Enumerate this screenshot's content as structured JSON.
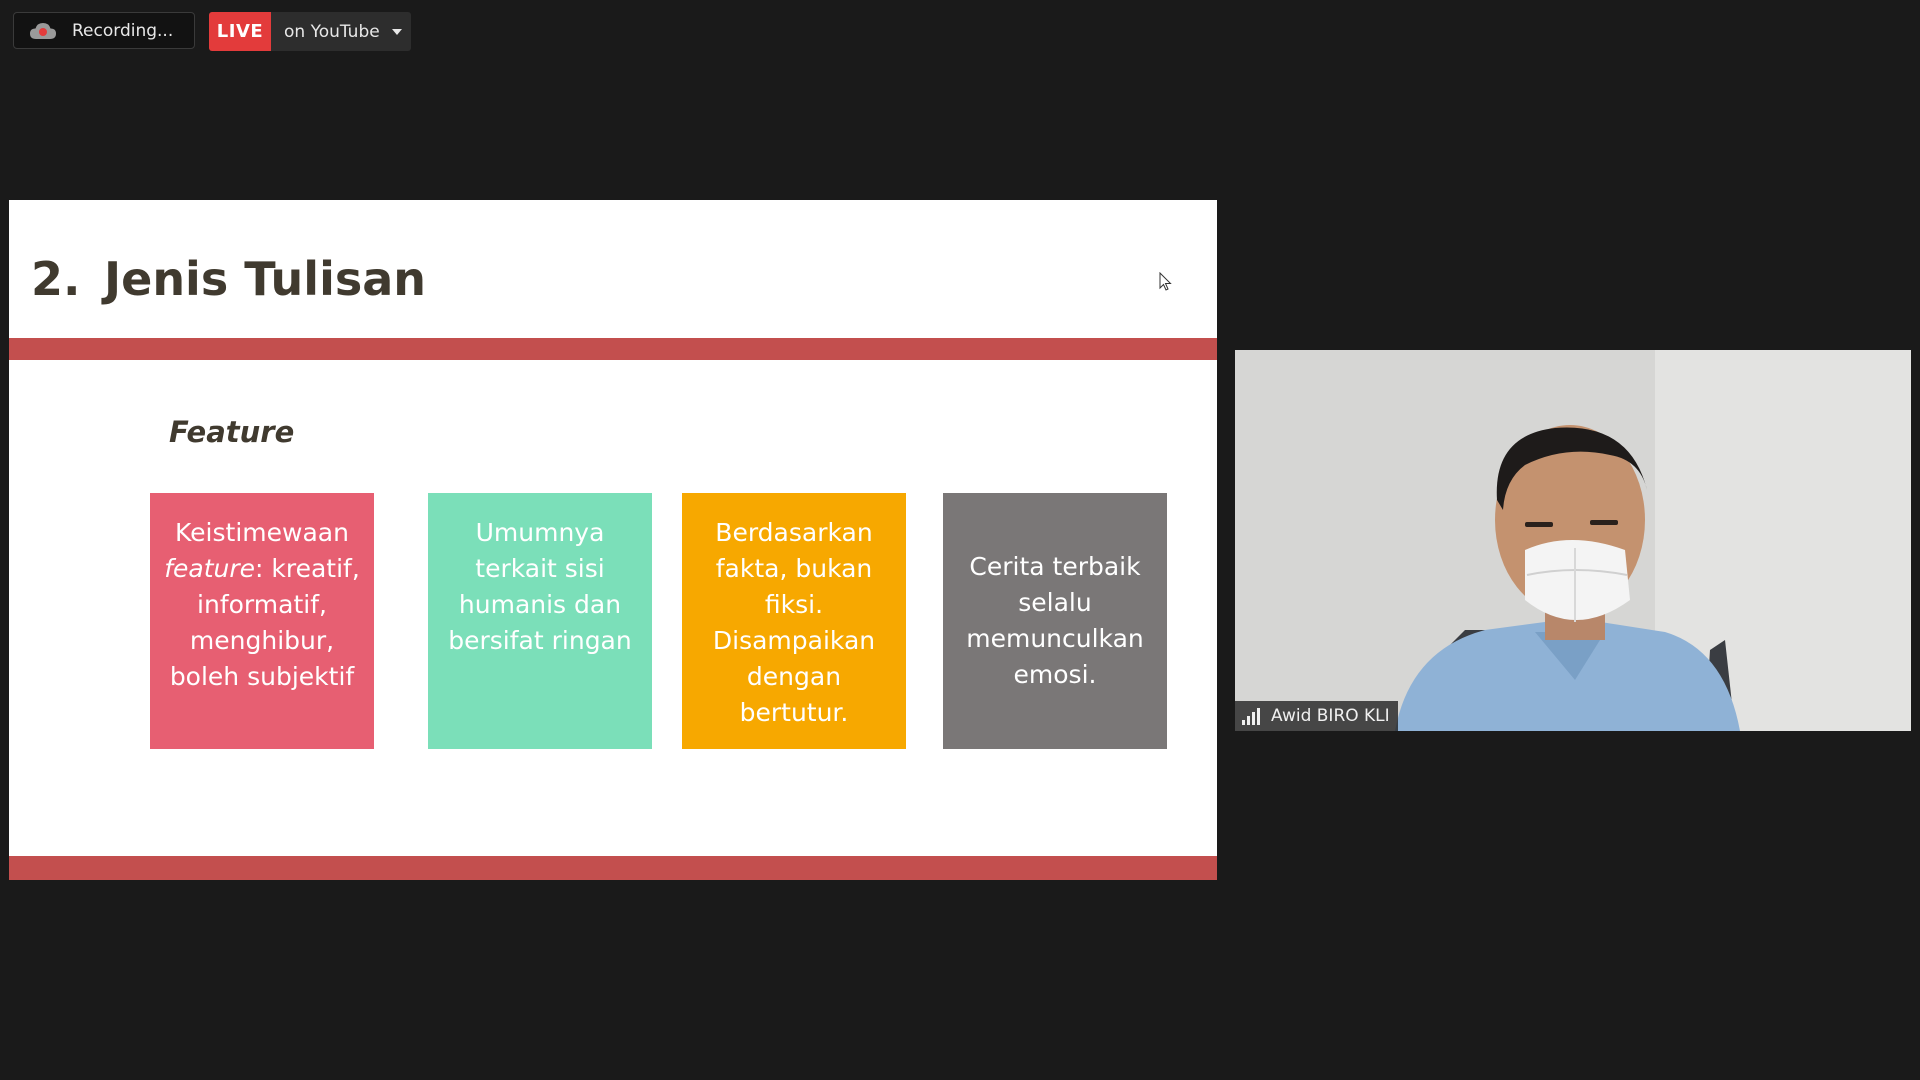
{
  "toolbar": {
    "recording_label": "Recording...",
    "live_label": "LIVE",
    "live_destination": "on YouTube"
  },
  "slide": {
    "number": "2.",
    "title": "Jenis Tulisan",
    "subtitle": "Feature",
    "cards": [
      {
        "em": "feature",
        "lead": "Keistimewaan",
        "rest": ": kreatif, informatif, menghibur, boleh subjektif"
      },
      {
        "text": "Umumnya terkait sisi humanis dan bersifat ringan"
      },
      {
        "text": "Berdasarkan fakta, bukan fiksi. Disampaikan dengan bertutur."
      },
      {
        "text": "Cerita terbaik selalu memunculkan emosi."
      }
    ],
    "colors": {
      "title": "#403a2f",
      "band": "#c34f4e",
      "card1": "#e75f72",
      "card2": "#7bdfb9",
      "card3": "#f7a800",
      "card4": "#7a7777"
    }
  },
  "participant": {
    "name": "Awid BIRO KLI",
    "icons": [
      "signal-strength-icon"
    ]
  },
  "icons": {
    "recording": "cloud-record-icon",
    "dropdown": "chevron-down-icon",
    "cursor": "mouse-pointer-icon"
  }
}
